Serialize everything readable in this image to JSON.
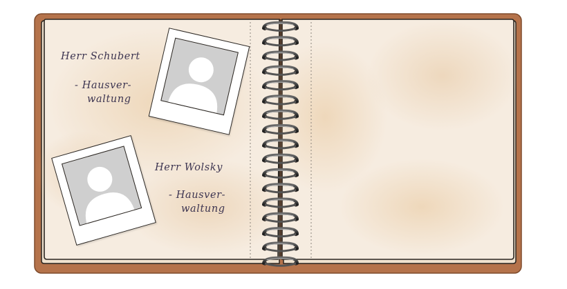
{
  "contacts": [
    {
      "name": "Herr Schubert",
      "role_line1": "- Hausver-",
      "role_line2": "waltung",
      "photo_icon": "person-placeholder-icon"
    },
    {
      "name": "Herr Wolsky",
      "role_line1": "- Hausver-",
      "role_line2": "waltung",
      "photo_icon": "person-placeholder-icon"
    }
  ],
  "colors": {
    "cover": "#b5734b",
    "page": "#f6ece0",
    "ink": "#3d3551",
    "photo_placeholder": "#cfcfcf"
  }
}
